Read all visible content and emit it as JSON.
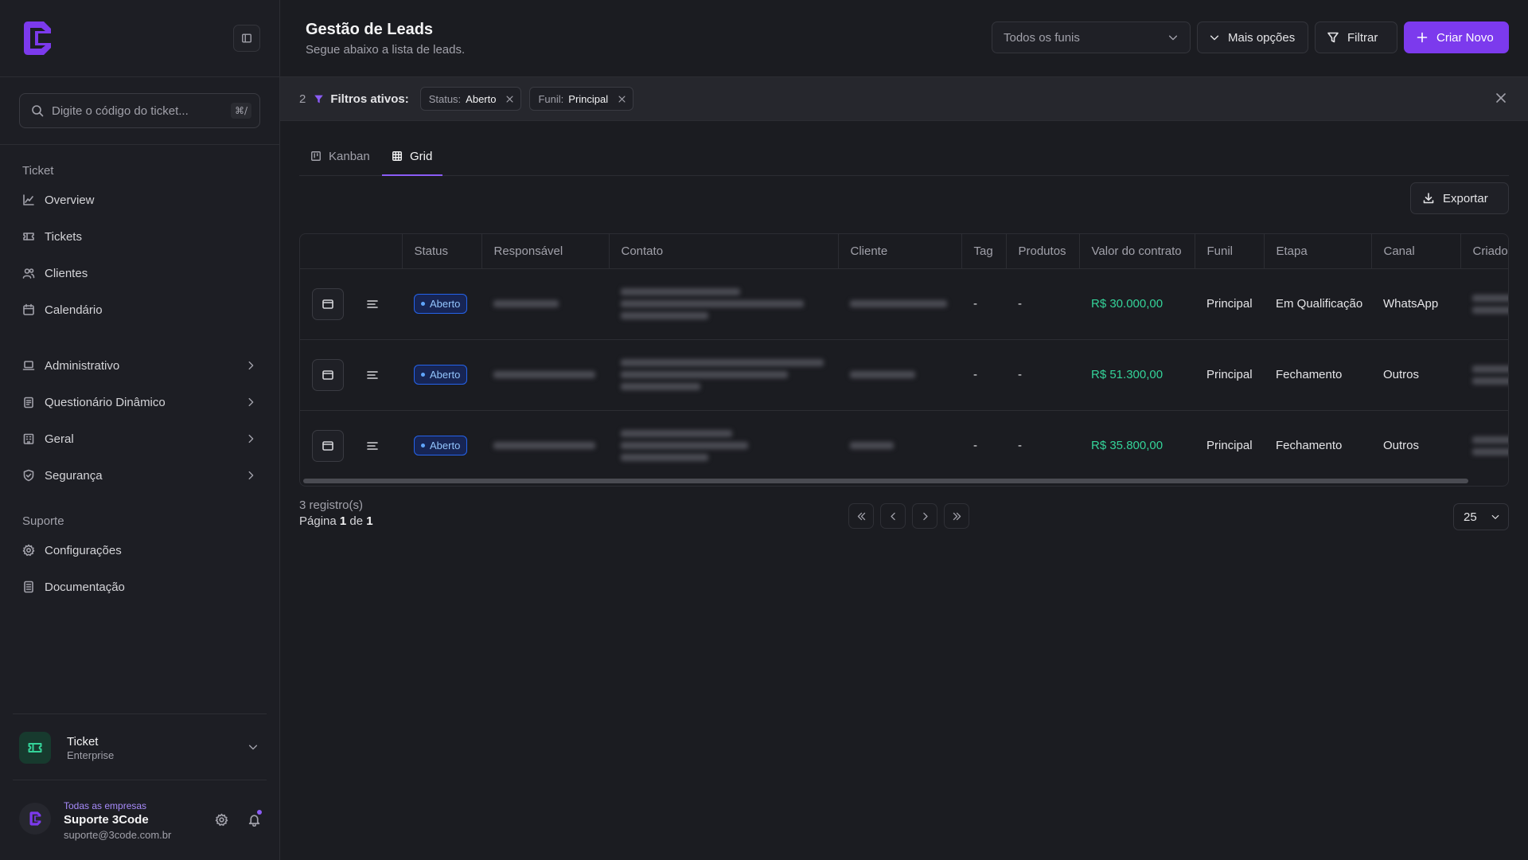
{
  "sidebar": {
    "search": {
      "placeholder": "Digite o código do ticket...",
      "shortcut": "⌘/"
    },
    "sections": [
      {
        "title": "Ticket",
        "items": [
          {
            "label": "Overview",
            "icon": "chart-line-icon"
          },
          {
            "label": "Tickets",
            "icon": "ticket-icon"
          },
          {
            "label": "Clientes",
            "icon": "users-icon"
          },
          {
            "label": "Calendário",
            "icon": "calendar-icon"
          }
        ]
      },
      {
        "title": "",
        "items": [
          {
            "label": "Administrativo",
            "icon": "laptop-icon"
          },
          {
            "label": "Questionário Dinâmico",
            "icon": "clipboard-icon"
          },
          {
            "label": "Geral",
            "icon": "building-icon"
          },
          {
            "label": "Segurança",
            "icon": "shield-icon"
          }
        ]
      },
      {
        "title": "Suporte",
        "items": [
          {
            "label": "Configurações",
            "icon": "gear-icon"
          },
          {
            "label": "Documentação",
            "icon": "document-icon"
          }
        ]
      }
    ],
    "org": {
      "name": "Ticket",
      "plan": "Enterprise"
    },
    "user": {
      "company": "Todas as empresas",
      "name": "Suporte 3Code",
      "email": "suporte@3code.com.br"
    }
  },
  "header": {
    "title": "Gestão de Leads",
    "subtitle": "Segue abaixo a lista de leads.",
    "funnel_select": "Todos os funis",
    "more_options": "Mais opções",
    "filter": "Filtrar",
    "create": "Criar Novo"
  },
  "filters": {
    "count": "2",
    "label": "Filtros ativos:",
    "chips": [
      {
        "key": "Status:",
        "value": "Aberto"
      },
      {
        "key": "Funil:",
        "value": "Principal"
      }
    ]
  },
  "tabs": [
    {
      "label": "Kanban"
    },
    {
      "label": "Grid"
    }
  ],
  "export": "Exportar",
  "table": {
    "columns": [
      "Status",
      "Responsável",
      "Contato",
      "Cliente",
      "Tag",
      "Produtos",
      "Valor do contrato",
      "Funil",
      "Etapa",
      "Canal",
      "Criado por"
    ],
    "rows": [
      {
        "status": "Aberto",
        "tag": "-",
        "produtos": "-",
        "valor": "R$ 30.000,00",
        "funil": "Principal",
        "etapa": "Em Qualificação",
        "canal": "WhatsApp"
      },
      {
        "status": "Aberto",
        "tag": "-",
        "produtos": "-",
        "valor": "R$ 51.300,00",
        "funil": "Principal",
        "etapa": "Fechamento",
        "canal": "Outros"
      },
      {
        "status": "Aberto",
        "tag": "-",
        "produtos": "-",
        "valor": "R$ 35.800,00",
        "funil": "Principal",
        "etapa": "Fechamento",
        "canal": "Outros"
      }
    ]
  },
  "footer": {
    "records": "3 registro(s)",
    "page_word": "Página",
    "page_current": "1",
    "page_of": "de",
    "page_total": "1",
    "page_size": "25"
  },
  "colors": {
    "accent": "#7c3aed",
    "money": "#34d399",
    "status": "#2563eb"
  }
}
